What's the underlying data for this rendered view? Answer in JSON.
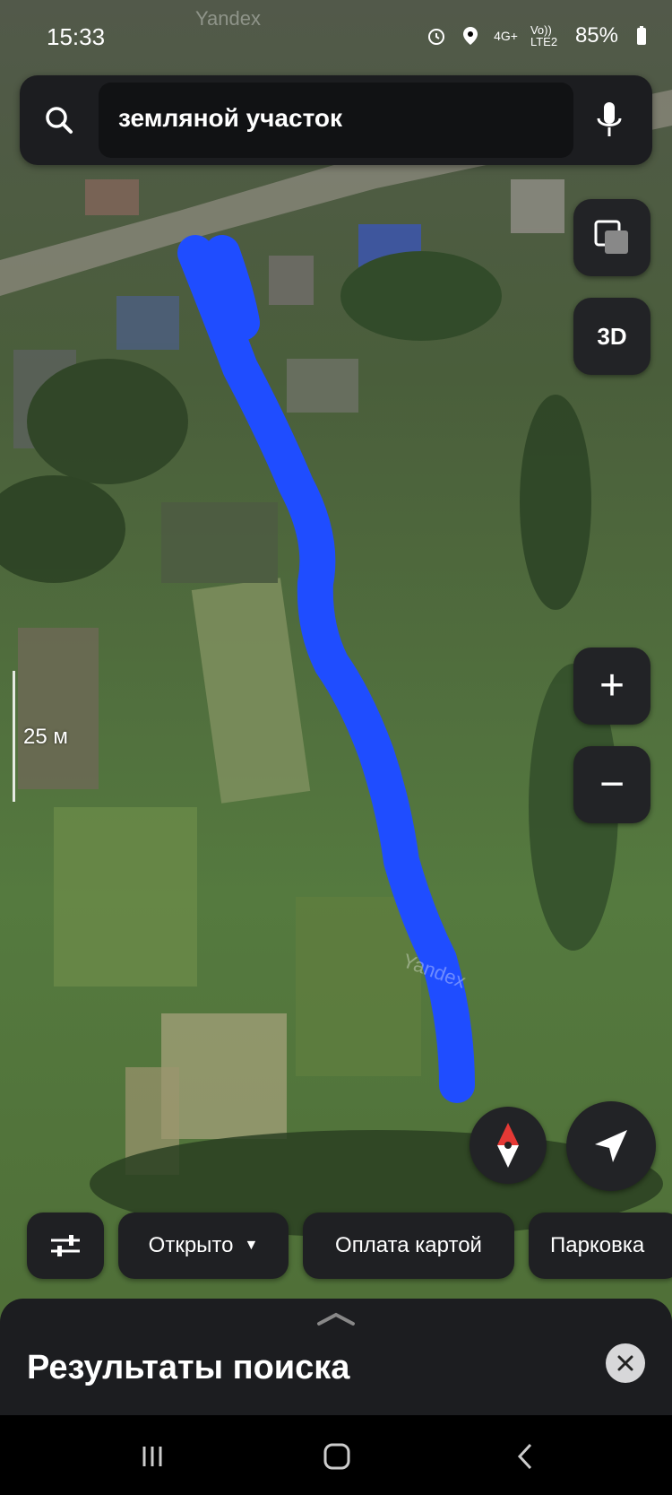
{
  "status_bar": {
    "time": "15:33",
    "network_label": "4G+",
    "volte_label": "Vo)) LTE2",
    "battery": "85%"
  },
  "search": {
    "query": "земляной участок",
    "search_icon": "search-icon",
    "mic_icon": "microphone-icon"
  },
  "map_controls": {
    "layers_icon": "layers-icon",
    "three_d_label": "3D",
    "zoom_in": "+",
    "zoom_out": "−",
    "compass_icon": "compass-icon",
    "locate_icon": "navigation-arrow-icon"
  },
  "map": {
    "scale_label": "25 м",
    "watermark": "Yandex",
    "route_color": "#1f4dff"
  },
  "filters": {
    "filter_icon": "sliders-icon",
    "chips": [
      "Открыто",
      "Оплата картой",
      "Парковка"
    ]
  },
  "bottom_sheet": {
    "title": "Результаты поиска",
    "close_icon": "close-icon"
  },
  "nav_bar": {
    "recent_icon": "recent-apps-icon",
    "home_icon": "home-icon",
    "back_icon": "back-icon"
  },
  "colors": {
    "panel": "#1c1d20",
    "button": "#222326",
    "compass_red": "#e53935"
  }
}
